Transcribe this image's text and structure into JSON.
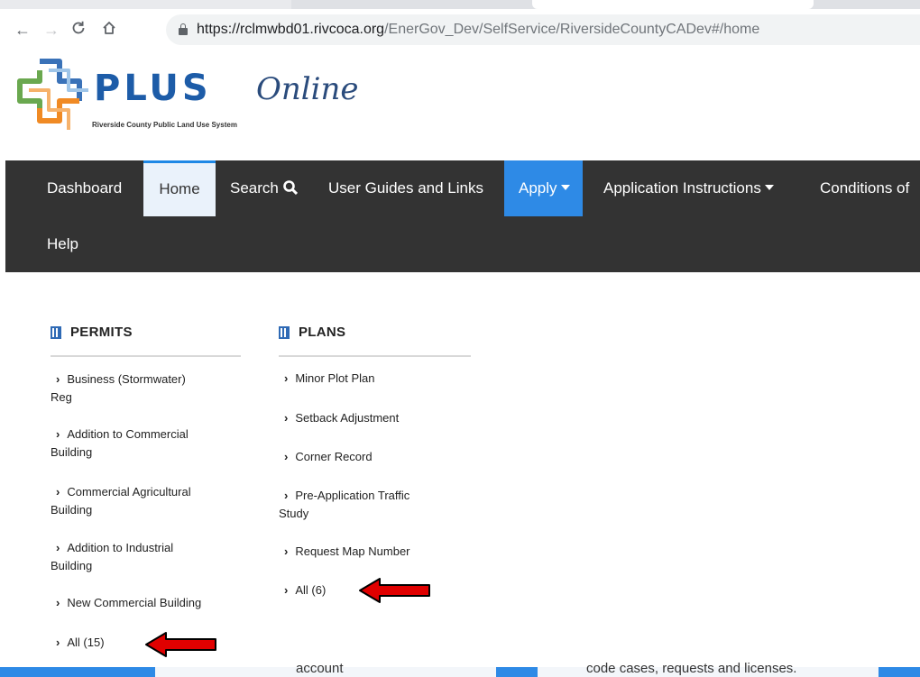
{
  "browser": {
    "url_host": "https://rclmwbd01.rivcoca.org",
    "url_path": "/EnerGov_Dev/SelfService/RiversideCountyCADev#/home"
  },
  "logo": {
    "word": "PLUS",
    "suffix": "Online",
    "tagline": "Riverside County Public Land Use System"
  },
  "nav": {
    "dashboard": "Dashboard",
    "home": "Home",
    "search": "Search",
    "user_guides": "User Guides and Links",
    "apply": "Apply",
    "app_instructions": "Application Instructions",
    "conditions": "Conditions of",
    "help": "Help"
  },
  "permits": {
    "title": "PERMITS",
    "items": [
      {
        "l1": "Business (Stormwater)",
        "l2": "Reg"
      },
      {
        "l1": "Addition to Commercial",
        "l2": "Building"
      },
      {
        "l1": "Commercial Agricultural",
        "l2": "Building"
      },
      {
        "l1": "Addition to Industrial",
        "l2": "Building"
      },
      {
        "l1": "New Commercial Building",
        "l2": ""
      },
      {
        "l1": "All (15)",
        "l2": ""
      }
    ]
  },
  "plans": {
    "title": "PLANS",
    "items": [
      {
        "l1": "Minor Plot Plan",
        "l2": ""
      },
      {
        "l1": "Setback Adjustment",
        "l2": ""
      },
      {
        "l1": "Corner Record",
        "l2": ""
      },
      {
        "l1": "Pre-Application Traffic",
        "l2": "Study"
      },
      {
        "l1": "Request Map Number",
        "l2": ""
      },
      {
        "l1": "All (6)",
        "l2": ""
      }
    ]
  },
  "bottom": {
    "left_text": "account",
    "right_text": "code cases, requests and licenses."
  },
  "colors": {
    "nav_bg": "#333333",
    "apply_bg": "#2e8ae6",
    "brand_blue": "#1d5ca8",
    "arrow_red": "#e00000"
  }
}
